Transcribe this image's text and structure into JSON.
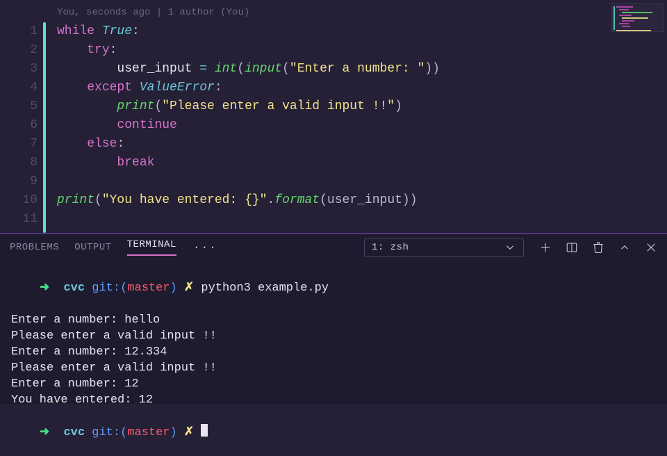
{
  "gitlens": "You, seconds ago | 1 author (You)",
  "editor": {
    "gutter": [
      "1",
      "2",
      "3",
      "4",
      "5",
      "6",
      "7",
      "8",
      "9",
      "10",
      "11"
    ],
    "tokens": [
      [
        {
          "t": "while ",
          "c": "tk-kw"
        },
        {
          "t": "True",
          "c": "tk-cls"
        },
        {
          "t": ":",
          "c": "tk-punct"
        }
      ],
      [
        {
          "t": "    ",
          "c": ""
        },
        {
          "t": "try",
          "c": "tk-kw"
        },
        {
          "t": ":",
          "c": "tk-punct"
        }
      ],
      [
        {
          "t": "        user_input ",
          "c": "tk-id"
        },
        {
          "t": "= ",
          "c": "tk-op"
        },
        {
          "t": "int",
          "c": "tk-fn"
        },
        {
          "t": "(",
          "c": "tk-punct"
        },
        {
          "t": "input",
          "c": "tk-fn"
        },
        {
          "t": "(",
          "c": "tk-punct"
        },
        {
          "t": "\"Enter a number: \"",
          "c": "tk-str"
        },
        {
          "t": "))",
          "c": "tk-punct"
        }
      ],
      [
        {
          "t": "    ",
          "c": ""
        },
        {
          "t": "except ",
          "c": "tk-kw"
        },
        {
          "t": "ValueError",
          "c": "tk-cls"
        },
        {
          "t": ":",
          "c": "tk-punct"
        }
      ],
      [
        {
          "t": "        ",
          "c": ""
        },
        {
          "t": "print",
          "c": "tk-fn"
        },
        {
          "t": "(",
          "c": "tk-punct"
        },
        {
          "t": "\"Please enter a valid input !!\"",
          "c": "tk-str"
        },
        {
          "t": ")",
          "c": "tk-punct"
        }
      ],
      [
        {
          "t": "        ",
          "c": ""
        },
        {
          "t": "continue",
          "c": "tk-kw"
        }
      ],
      [
        {
          "t": "    ",
          "c": ""
        },
        {
          "t": "else",
          "c": "tk-kw"
        },
        {
          "t": ":",
          "c": "tk-punct"
        }
      ],
      [
        {
          "t": "        ",
          "c": ""
        },
        {
          "t": "break",
          "c": "tk-kw"
        }
      ],
      [],
      [
        {
          "t": "print",
          "c": "tk-fn"
        },
        {
          "t": "(",
          "c": "tk-punct"
        },
        {
          "t": "\"You have entered: ",
          "c": "tk-str"
        },
        {
          "t": "{}",
          "c": "tk-str"
        },
        {
          "t": "\"",
          "c": "tk-str"
        },
        {
          "t": ".",
          "c": "tk-punct"
        },
        {
          "t": "format",
          "c": "tk-fn"
        },
        {
          "t": "(user_input))",
          "c": "tk-punct"
        }
      ],
      []
    ]
  },
  "panel": {
    "tabs": [
      {
        "label": "PROBLEMS",
        "active": false
      },
      {
        "label": "OUTPUT",
        "active": false
      },
      {
        "label": "TERMINAL",
        "active": true
      }
    ],
    "more": "···",
    "picker": "1: zsh"
  },
  "terminal": {
    "prompt_arrow": "➜",
    "cwd": "cvc",
    "git_label": "git:",
    "branch": "master",
    "x": "✗",
    "cmd1": "python3 example.py",
    "lines": [
      "Enter a number: hello",
      "Please enter a valid input !!",
      "Enter a number: 12.334",
      "Please enter a valid input !!",
      "Enter a number: 12",
      "You have entered: 12"
    ]
  }
}
